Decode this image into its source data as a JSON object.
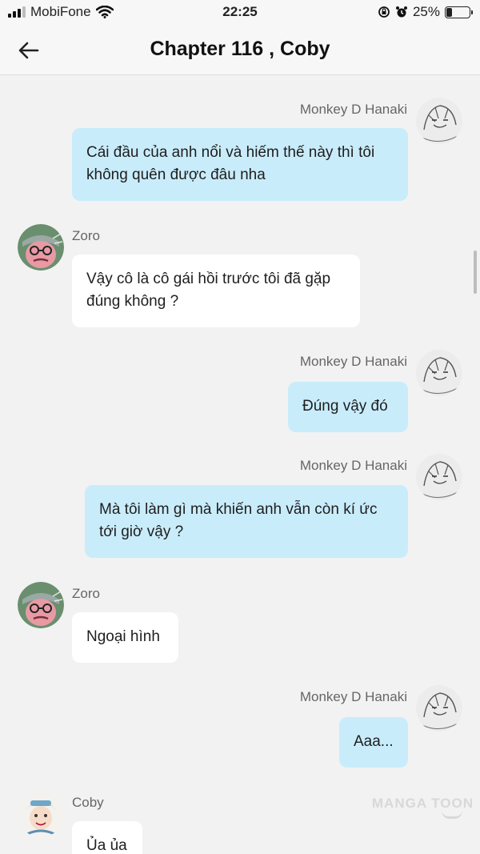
{
  "status_bar": {
    "carrier": "MobiFone",
    "time": "22:25",
    "battery": "25%",
    "battery_level": 0.25
  },
  "header": {
    "title": "Chapter 116 , Coby",
    "back_icon": "arrow-left-icon"
  },
  "messages": [
    {
      "sender": "Monkey D Hanaki",
      "side": "right",
      "text": "Cái đầu của anh nổi và hiếm thế này thì tôi không quên được đâu nha"
    },
    {
      "sender": "Zoro",
      "side": "left",
      "text": "Vậy cô là cô gái hồi trước tôi đã gặp đúng không ?"
    },
    {
      "sender": "Monkey D Hanaki",
      "side": "right",
      "text": "Đúng vậy đó"
    },
    {
      "sender": "Monkey D Hanaki",
      "side": "right",
      "text": "Mà tôi làm gì mà khiến anh vẫn còn kí ức tới giờ vậy ?"
    },
    {
      "sender": "Zoro",
      "side": "left",
      "text": "Ngoại hình"
    },
    {
      "sender": "Monkey D Hanaki",
      "side": "right",
      "text": "Aaa..."
    },
    {
      "sender": "Coby",
      "side": "left",
      "text": "Ủa ủa"
    }
  ],
  "watermark": "MANGA TOON"
}
